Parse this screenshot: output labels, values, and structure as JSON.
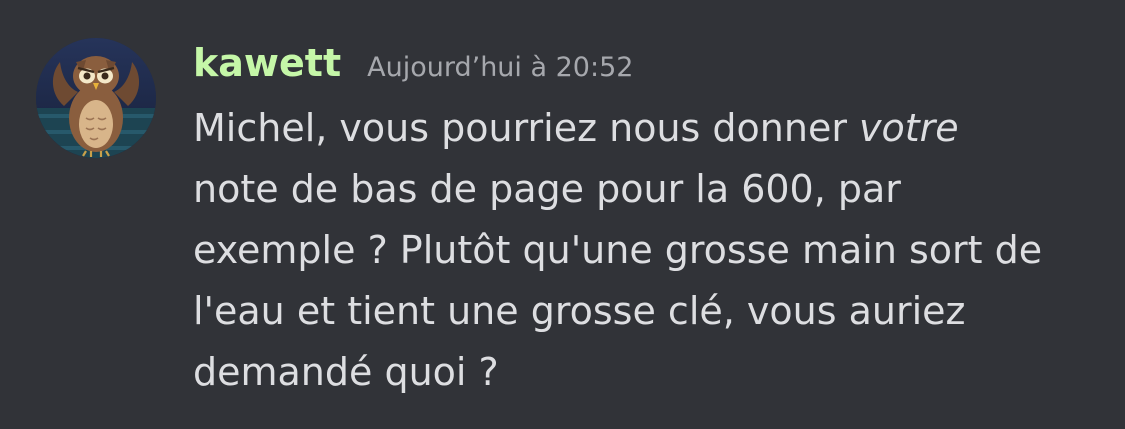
{
  "message": {
    "avatar_icon": "owl-avatar-icon",
    "username": "kawett",
    "timestamp": "Aujourd’hui à 20:52",
    "lines": [
      {
        "before": "Michel, vous pourriez nous donner ",
        "emphasis": "votre"
      },
      {
        "text": "note de bas de page pour la 600, par"
      },
      {
        "text": "exemple ? Plutôt qu'une grosse main sort de"
      },
      {
        "text": "l'eau et tient une grosse clé, vous auriez"
      },
      {
        "text": "demandé quoi ?"
      }
    ]
  },
  "colors": {
    "background": "#313338",
    "username": "#c5f7a8",
    "timestamp": "#a6a8ad",
    "message_text": "#dddee1"
  }
}
